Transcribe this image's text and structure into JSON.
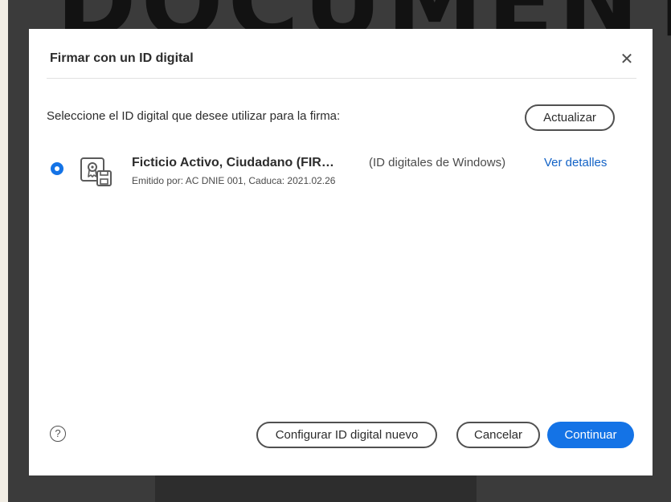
{
  "background": {
    "heading": "DOCUMENTO"
  },
  "dialog": {
    "title": "Firmar con un ID digital",
    "close_icon": "close-icon",
    "prompt": "Seleccione el ID digital que desee utilizar para la firma:",
    "refresh_label": "Actualizar",
    "selected_id": {
      "selected": true,
      "icon": "digital-certificate-icon",
      "name": "Ficticio Activo, Ciudadano (FIR…",
      "source": "(ID digitales de Windows)",
      "details_link": "Ver detalles",
      "issuer": "Emitido por: AC DNIE 001, Caduca: 2021.02.26"
    },
    "footer": {
      "help_icon": "help-icon",
      "help_symbol": "?",
      "configure_label": "Configurar ID digital nuevo",
      "cancel_label": "Cancelar",
      "continue_label": "Continuar"
    },
    "colors": {
      "accent": "#1473e6",
      "link": "#1262c6"
    }
  }
}
